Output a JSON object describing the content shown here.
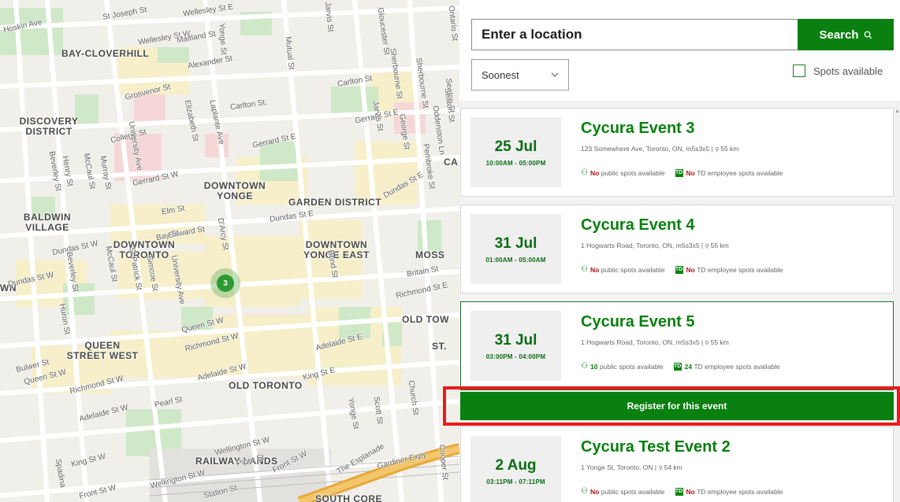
{
  "map": {
    "cluster_count": "3",
    "districts": [
      "BAY-CLOVERHILL",
      "DISCOVERY DISTRICT",
      "DOWNTOWN YONGE",
      "GARDEN DISTRICT",
      "BALDWIN VILLAGE",
      "DOWNTOWN TORONTO",
      "DOWNTOWN YONGE EAST",
      "MOSS",
      "QUEEN STREET WEST",
      "OLD TORONTO",
      "RAILWAY LANDS",
      "OLD TOW",
      "ST.",
      "CA",
      "WN",
      "SOUTH CORE"
    ],
    "streets": [
      "Hoskin Ave",
      "St Joseph St",
      "Wellesley St E",
      "Wellesley St W",
      "Maitland St",
      "Alexander St",
      "Yonge St",
      "Jarvis St",
      "Mutual St",
      "Carlton St",
      "Sherbourne St",
      "Ontario St",
      "Grosvenor St",
      "Carlton St.",
      "Gerrard St E",
      "Seaton St",
      "College St",
      "Elizabeth St",
      "Laplante Ave",
      "Gerrard St E",
      "Jarvis St",
      "George St",
      "Dundas St E",
      "University Ave",
      "Beverley St",
      "Henry St",
      "McCaul St",
      "Murray St",
      "Gerrard St W",
      "Elm St",
      "Dundas St E",
      "Edward St",
      "Dundas St W",
      "D'Arcy St",
      "Bay St",
      "Dundas St W",
      "Beverley St",
      "McCaul St",
      "St Patrick St",
      "Simcoe St",
      "University Ave",
      "Bond St",
      "Britain St",
      "Richmond St E",
      "Queen St W",
      "Richmond St W",
      "Adelaide St E",
      "Huron St",
      "Bulwer St",
      "Queen St W",
      "Richmond St W",
      "Adelaide St W",
      "King St E",
      "Adelaide St W",
      "Pearl St",
      "Yonge St",
      "Scott St",
      "Church St",
      "King St W",
      "Wellington St W",
      "Piper St",
      "Front St W",
      "The Esplanade",
      "Wellington St W",
      "Station St",
      "Gardiner Expy",
      "Cooper St",
      "Spadina",
      "Front St W",
      "Sherbourne St",
      "Seaton St",
      "Oddenston Ln",
      "Pembroke St",
      "Gloucester St"
    ]
  },
  "search": {
    "placeholder": "Enter a location",
    "button_label": "Search",
    "sort_selected": "Soonest",
    "spots_label": "Spots available"
  },
  "events": [
    {
      "day": "25 Jul",
      "time": "10:00AM - 05:00PM",
      "title": "Cycura Event 3",
      "address": "123 Somewhere Ave, Toronto, ON, m5s3x5",
      "distance": "55 km",
      "public_count": "No",
      "public_text": "public spots available",
      "td_count": "No",
      "td_text": "TD employee spots available"
    },
    {
      "day": "31 Jul",
      "time": "01:00AM - 05:00AM",
      "title": "Cycura Event 4",
      "address": "1 Hogwarts Road, Toronto, ON, m5s3x5",
      "distance": "55 km",
      "public_count": "No",
      "public_text": "public spots available",
      "td_count": "No",
      "td_text": "TD employee spots available"
    },
    {
      "day": "31 Jul",
      "time": "03:00PM - 04:00PM",
      "title": "Cycura Event 5",
      "address": "1 Hogwarts Road, Toronto, ON, m5s3x5",
      "distance": "55 km",
      "public_count": "10",
      "public_text": "public spots available",
      "td_count": "24",
      "td_text": "TD employee spots available"
    },
    {
      "day": "2 Aug",
      "time": "03:11PM - 07:11PM",
      "title": "Cycura Test Event 2",
      "address": "1 Yonge St, Toronto, ON",
      "distance": "54 km",
      "public_count": "No",
      "public_text": "public spots available",
      "td_count": "No",
      "td_text": "TD employee spots available"
    }
  ],
  "register_label": "Register for this event",
  "colors": {
    "brand_green": "#0a8010",
    "no_red": "#b31616",
    "highlight": "#ea1b1b"
  },
  "icons": {
    "search": "search-icon",
    "chevron": "chevron-down-icon",
    "people": "people-icon",
    "td": "td-logo-icon",
    "pin": "pin-icon"
  }
}
